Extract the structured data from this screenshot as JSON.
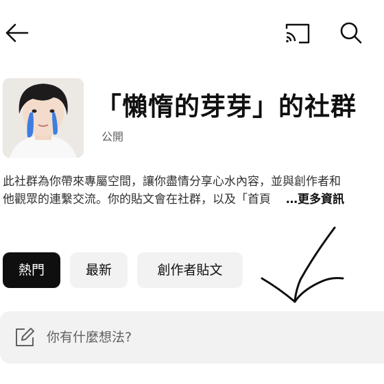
{
  "top_bar": {
    "back_icon": "arrow-left-icon",
    "cast_icon": "cast-icon",
    "search_icon": "search-icon"
  },
  "header": {
    "avatar": "avatar-image",
    "title": "「懶惰的芽芽」的社群",
    "visibility": "公開"
  },
  "description": {
    "line1": "此社群為你帶來專屬空間，讓你盡情分享心水內容，並與創作者和",
    "line2": "他觀眾的連繫交流。你的貼文會在社群，以及「首頁",
    "more_label": "…更多資訊"
  },
  "tabs": [
    {
      "label": "熱門",
      "active": true
    },
    {
      "label": "最新",
      "active": false
    },
    {
      "label": "創作者貼文",
      "active": false
    }
  ],
  "compose": {
    "icon": "edit-icon",
    "placeholder": "你有什麼想法?"
  },
  "colors": {
    "active_chip_bg": "#0f0f0f",
    "chip_bg": "#f2f2f2",
    "tear_blue": "#3d7ee0"
  }
}
